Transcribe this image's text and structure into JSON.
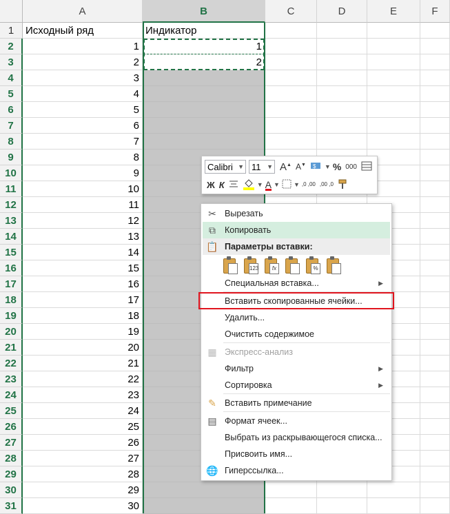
{
  "columns": [
    "A",
    "B",
    "C",
    "D",
    "E",
    "F"
  ],
  "selected_column": "B",
  "rows": [
    1,
    2,
    3,
    4,
    5,
    6,
    7,
    8,
    9,
    10,
    11,
    12,
    13,
    14,
    15,
    16,
    17,
    18,
    19,
    20,
    21,
    22,
    23,
    24,
    25,
    26,
    27,
    28,
    29,
    30,
    31
  ],
  "cells": {
    "A1": "Исходный ряд",
    "B1": "Индикатор",
    "B2": "1",
    "B3": "2",
    "col_a_values": [
      "1",
      "2",
      "3",
      "4",
      "5",
      "6",
      "7",
      "8",
      "9",
      "10",
      "11",
      "12",
      "13",
      "14",
      "15",
      "16",
      "17",
      "18",
      "19",
      "20",
      "21",
      "22",
      "23",
      "24",
      "25",
      "26",
      "27",
      "28",
      "29",
      "30"
    ]
  },
  "mini_toolbar": {
    "font_name": "Calibri",
    "font_size": "11",
    "grow_font": "A",
    "shrink_font": "A",
    "percent": "%",
    "thousands": "000",
    "bold": "Ж",
    "italic": "К",
    "font_color_letter": "A",
    "dec_increase": ",0 ,00",
    "dec_decrease": ",00 ,0",
    "font_color": "#e0141e",
    "fill_color": "#ffff00"
  },
  "context_menu": {
    "cut": "Вырезать",
    "copy": "Копировать",
    "paste_options": "Параметры вставки:",
    "paste_special": "Специальная вставка...",
    "insert_copied": "Вставить скопированные ячейки...",
    "delete": "Удалить...",
    "clear_contents": "Очистить содержимое",
    "quick_analysis": "Экспресс-анализ",
    "filter": "Фильтр",
    "sort": "Сортировка",
    "insert_comment": "Вставить примечание",
    "format_cells": "Формат ячеек...",
    "pick_from_list": "Выбрать из раскрывающегося списка...",
    "define_name": "Присвоить имя...",
    "hyperlink": "Гиперссылка...",
    "paste_icon_labels": [
      "",
      "123",
      "fx",
      "",
      "%",
      ""
    ]
  },
  "colors": {
    "accent": "#217346",
    "highlight": "#d5eedf",
    "callout": "#e0141e"
  }
}
